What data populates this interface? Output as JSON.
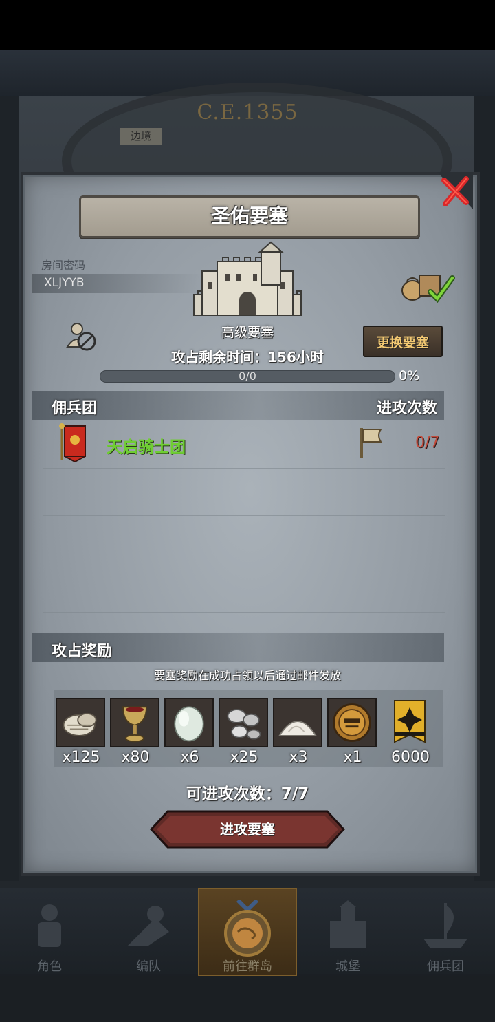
{
  "background": {
    "year": "C.E.1355",
    "border_tag": "边境"
  },
  "dialog": {
    "title": "圣佑要塞",
    "room_password_label": "房间密码",
    "room_password": "XLJYYB",
    "fort_grade": "高级要塞",
    "time_left": "攻占剩余时间：156小时",
    "change_fort_button": "更换要塞",
    "progress": {
      "text": "0/0",
      "percent_label": "0%",
      "fraction": 0
    },
    "mercenary_header": "佣兵团",
    "attack_count_header": "进攻次数",
    "guilds": [
      {
        "name": "天启骑士团",
        "attacks": "0/7"
      }
    ],
    "rewards_header": "攻占奖励",
    "reward_note": "要塞奖励在成功占领以后通过邮件发放",
    "rewards": [
      {
        "icon": "bread-icon",
        "qty": "x125"
      },
      {
        "icon": "goblet-icon",
        "qty": "x80"
      },
      {
        "icon": "gem-stone-icon",
        "qty": "x6"
      },
      {
        "icon": "silver-ore-icon",
        "qty": "x25"
      },
      {
        "icon": "salt-pile-icon",
        "qty": "x3"
      },
      {
        "icon": "knight-helmet-icon",
        "qty": "x1"
      },
      {
        "icon": "honor-banner-icon",
        "qty": "6000"
      }
    ],
    "attacks_available": "可进攻次数：7/7",
    "attack_button": "进攻要塞"
  },
  "nav": {
    "items": [
      "角色",
      "编队",
      "前往群岛",
      "城堡",
      "佣兵团"
    ]
  },
  "colors": {
    "guild_name": "#6fce33",
    "attack_count": "#c24a3a",
    "change_button_text": "#f2c872",
    "close_x": "#d8282a"
  }
}
